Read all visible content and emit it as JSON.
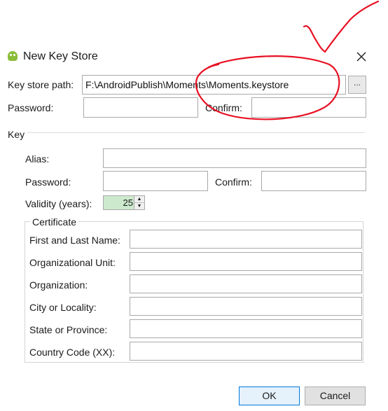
{
  "dialog": {
    "title": "New Key Store",
    "close_icon": "close-icon",
    "app_icon": "android-icon"
  },
  "keystore": {
    "path_label": "Key store path:",
    "path_value": "F:\\AndroidPublish\\Moments\\Moments.keystore",
    "browse_label": "...",
    "password_label": "Password:",
    "password_value": "",
    "confirm_label": "Confirm:",
    "confirm_value": ""
  },
  "key": {
    "section_label": "Key",
    "alias_label": "Alias:",
    "alias_value": "",
    "password_label": "Password:",
    "password_value": "",
    "confirm_label": "Confirm:",
    "confirm_value": "",
    "validity_label": "Validity (years):",
    "validity_value": "25"
  },
  "certificate": {
    "group_label": "Certificate",
    "fields": [
      {
        "label": "First and Last Name:",
        "value": ""
      },
      {
        "label": "Organizational Unit:",
        "value": ""
      },
      {
        "label": "Organization:",
        "value": ""
      },
      {
        "label": "City or Locality:",
        "value": ""
      },
      {
        "label": "State or Province:",
        "value": ""
      },
      {
        "label": "Country Code (XX):",
        "value": ""
      }
    ]
  },
  "buttons": {
    "ok_label": "OK",
    "cancel_label": "Cancel"
  },
  "annotation": {
    "color": "#e81123"
  }
}
